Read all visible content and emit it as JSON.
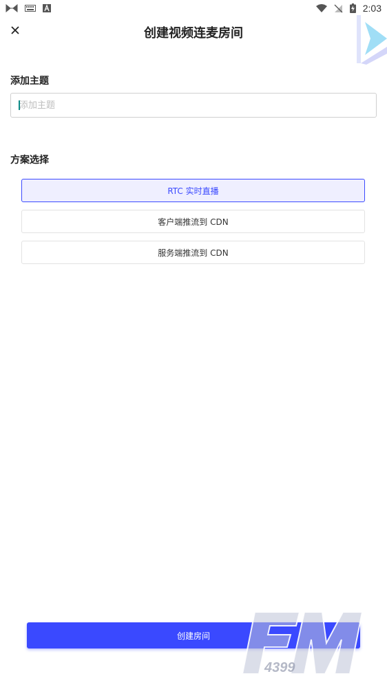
{
  "status_bar": {
    "time": "2:03",
    "left_icons": [
      "game-controller-icon",
      "keyboard-icon",
      "font-a-icon"
    ],
    "right_icons": [
      "wifi-icon",
      "no-signal-icon",
      "battery-charging-icon"
    ]
  },
  "header": {
    "title": "创建视频连麦房间",
    "close_icon": "close-icon"
  },
  "topic": {
    "label": "添加主题",
    "placeholder": "添加主题",
    "value": ""
  },
  "plan": {
    "label": "方案选择",
    "options": [
      {
        "label": "RTC 实时直播",
        "selected": true
      },
      {
        "label": "客户端推流到 CDN",
        "selected": false
      },
      {
        "label": "服务端推流到 CDN",
        "selected": false
      }
    ]
  },
  "footer": {
    "create_label": "创建房间"
  },
  "colors": {
    "accent": "#3a49ff",
    "selected_bg": "#efefff"
  }
}
